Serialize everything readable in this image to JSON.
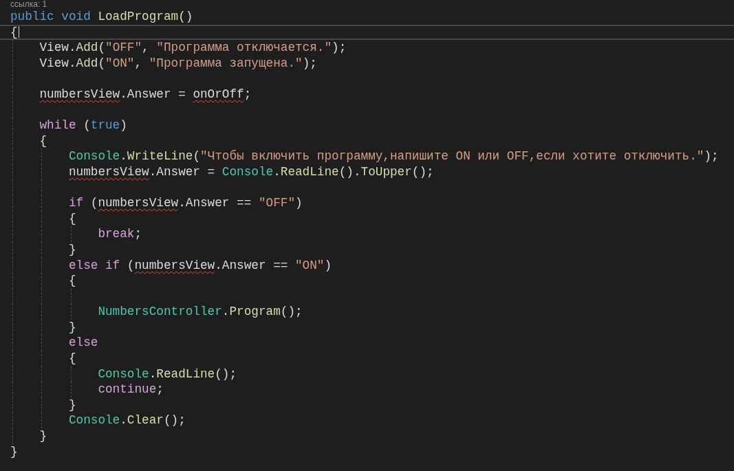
{
  "codelens": {
    "text": "ссылка: 1"
  },
  "lines": [
    {
      "current": false,
      "tokens": [
        {
          "text": "public ",
          "kind": "keyword"
        },
        {
          "text": "void ",
          "kind": "keyword"
        },
        {
          "text": "LoadProgram",
          "kind": "method"
        },
        {
          "text": "()",
          "kind": "plain"
        }
      ]
    },
    {
      "current": true,
      "tokens": [
        {
          "text": "{",
          "kind": "plain"
        }
      ]
    },
    {
      "current": false,
      "tokens": [
        {
          "text": "    View.",
          "kind": "plain"
        },
        {
          "text": "Add",
          "kind": "method"
        },
        {
          "text": "(",
          "kind": "plain"
        },
        {
          "text": "\"OFF\"",
          "kind": "string"
        },
        {
          "text": ", ",
          "kind": "plain"
        },
        {
          "text": "\"Программа отключается.\"",
          "kind": "string"
        },
        {
          "text": ");",
          "kind": "plain"
        }
      ]
    },
    {
      "current": false,
      "tokens": [
        {
          "text": "    View.",
          "kind": "plain"
        },
        {
          "text": "Add",
          "kind": "method"
        },
        {
          "text": "(",
          "kind": "plain"
        },
        {
          "text": "\"ON\"",
          "kind": "string"
        },
        {
          "text": ", ",
          "kind": "plain"
        },
        {
          "text": "\"Программа запущена.\"",
          "kind": "string"
        },
        {
          "text": ");",
          "kind": "plain"
        }
      ]
    },
    {
      "current": false
    },
    {
      "current": false,
      "tokens": [
        {
          "text": "    numbersView",
          "kind": "unresolved"
        },
        {
          "text": ".Answer = ",
          "kind": "plain"
        },
        {
          "text": "onOrOff",
          "kind": "unresolved"
        },
        {
          "text": ";",
          "kind": "plain"
        }
      ]
    },
    {
      "current": false
    },
    {
      "current": false,
      "tokens": [
        {
          "text": "    while ",
          "kind": "control"
        },
        {
          "text": "(",
          "kind": "plain"
        },
        {
          "text": "true",
          "kind": "keyword"
        },
        {
          "text": ")",
          "kind": "plain"
        }
      ]
    },
    {
      "current": false,
      "tokens": [
        {
          "text": "    {",
          "kind": "plain"
        }
      ]
    },
    {
      "current": false,
      "tokens": [
        {
          "text": "        Console",
          "kind": "type"
        },
        {
          "text": ".",
          "kind": "plain"
        },
        {
          "text": "WriteLine",
          "kind": "method"
        },
        {
          "text": "(",
          "kind": "plain"
        },
        {
          "text": "\"Чтобы включить программу,напишите ON или OFF,если хотите отключить.\"",
          "kind": "string"
        },
        {
          "text": ");",
          "kind": "plain"
        }
      ]
    },
    {
      "current": false,
      "tokens": [
        {
          "text": "        numbersView",
          "kind": "unresolved"
        },
        {
          "text": ".Answer = ",
          "kind": "plain"
        },
        {
          "text": "Console",
          "kind": "type"
        },
        {
          "text": ".",
          "kind": "plain"
        },
        {
          "text": "ReadLine",
          "kind": "method"
        },
        {
          "text": "().",
          "kind": "plain"
        },
        {
          "text": "ToUpper",
          "kind": "method"
        },
        {
          "text": "();",
          "kind": "plain"
        }
      ]
    },
    {
      "current": false
    },
    {
      "current": false,
      "tokens": [
        {
          "text": "        if ",
          "kind": "control"
        },
        {
          "text": "(",
          "kind": "plain"
        },
        {
          "text": "numbersView",
          "kind": "unresolved"
        },
        {
          "text": ".Answer == ",
          "kind": "plain"
        },
        {
          "text": "\"OFF\"",
          "kind": "string"
        },
        {
          "text": ")",
          "kind": "plain"
        }
      ]
    },
    {
      "current": false,
      "tokens": [
        {
          "text": "        {",
          "kind": "plain"
        }
      ]
    },
    {
      "current": false,
      "tokens": [
        {
          "text": "            break",
          "kind": "control"
        },
        {
          "text": ";",
          "kind": "plain"
        }
      ]
    },
    {
      "current": false,
      "tokens": [
        {
          "text": "        }",
          "kind": "plain"
        }
      ]
    },
    {
      "current": false,
      "tokens": [
        {
          "text": "        else if ",
          "kind": "control"
        },
        {
          "text": "(",
          "kind": "plain"
        },
        {
          "text": "numbersView",
          "kind": "unresolved"
        },
        {
          "text": ".Answer == ",
          "kind": "plain"
        },
        {
          "text": "\"ON\"",
          "kind": "string"
        },
        {
          "text": ")",
          "kind": "plain"
        }
      ]
    },
    {
      "current": false,
      "tokens": [
        {
          "text": "        {",
          "kind": "plain"
        }
      ]
    },
    {
      "current": false
    },
    {
      "current": false,
      "tokens": [
        {
          "text": "            NumbersController",
          "kind": "type"
        },
        {
          "text": ".",
          "kind": "plain"
        },
        {
          "text": "Program",
          "kind": "method"
        },
        {
          "text": "();",
          "kind": "plain"
        }
      ]
    },
    {
      "current": false,
      "tokens": [
        {
          "text": "        }",
          "kind": "plain"
        }
      ]
    },
    {
      "current": false,
      "tokens": [
        {
          "text": "        else",
          "kind": "control"
        }
      ]
    },
    {
      "current": false,
      "tokens": [
        {
          "text": "        {",
          "kind": "plain"
        }
      ]
    },
    {
      "current": false,
      "tokens": [
        {
          "text": "            Console",
          "kind": "type"
        },
        {
          "text": ".",
          "kind": "plain"
        },
        {
          "text": "ReadLine",
          "kind": "method"
        },
        {
          "text": "();",
          "kind": "plain"
        }
      ]
    },
    {
      "current": false,
      "tokens": [
        {
          "text": "            continue",
          "kind": "control"
        },
        {
          "text": ";",
          "kind": "plain"
        }
      ]
    },
    {
      "current": false,
      "tokens": [
        {
          "text": "        }",
          "kind": "plain"
        }
      ]
    },
    {
      "current": false,
      "tokens": [
        {
          "text": "        Console",
          "kind": "type"
        },
        {
          "text": ".",
          "kind": "plain"
        },
        {
          "text": "Clear",
          "kind": "method"
        },
        {
          "text": "();",
          "kind": "plain"
        }
      ]
    },
    {
      "current": false,
      "tokens": [
        {
          "text": "    }",
          "kind": "plain"
        }
      ]
    },
    {
      "current": false,
      "tokens": [
        {
          "text": "}",
          "kind": "plain"
        }
      ]
    }
  ]
}
